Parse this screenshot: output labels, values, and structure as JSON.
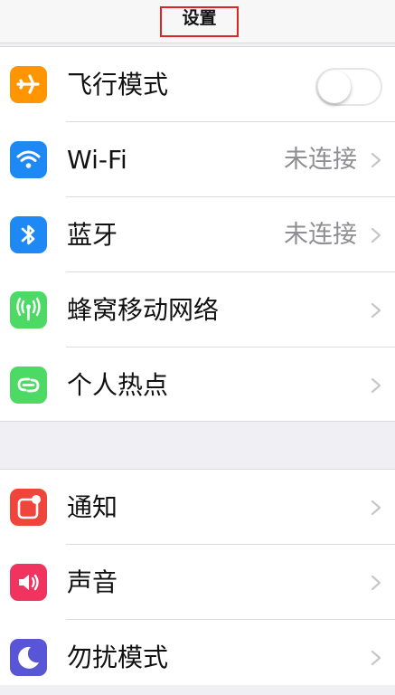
{
  "header": {
    "title": "设置"
  },
  "section1": {
    "airplane": {
      "label": "飞行模式",
      "icon": "airplane-icon",
      "color": "#ff9500",
      "toggle_on": false
    },
    "wifi": {
      "label": "Wi-Fi",
      "value": "未连接",
      "icon": "wifi-icon",
      "color": "#1e88f5"
    },
    "bluetooth": {
      "label": "蓝牙",
      "value": "未连接",
      "icon": "bluetooth-icon",
      "color": "#1e88f5"
    },
    "cellular": {
      "label": "蜂窝移动网络",
      "icon": "cellular-antenna-icon",
      "color": "#4cd964"
    },
    "hotspot": {
      "label": "个人热点",
      "icon": "hotspot-link-icon",
      "color": "#4cd964"
    }
  },
  "section2": {
    "notifications": {
      "label": "通知",
      "icon": "notifications-icon",
      "color": "#f0453a"
    },
    "sounds": {
      "label": "声音",
      "icon": "speaker-icon",
      "color": "#f0345f"
    },
    "dnd": {
      "label": "勿扰模式",
      "icon": "moon-icon",
      "color": "#5856d6"
    }
  }
}
